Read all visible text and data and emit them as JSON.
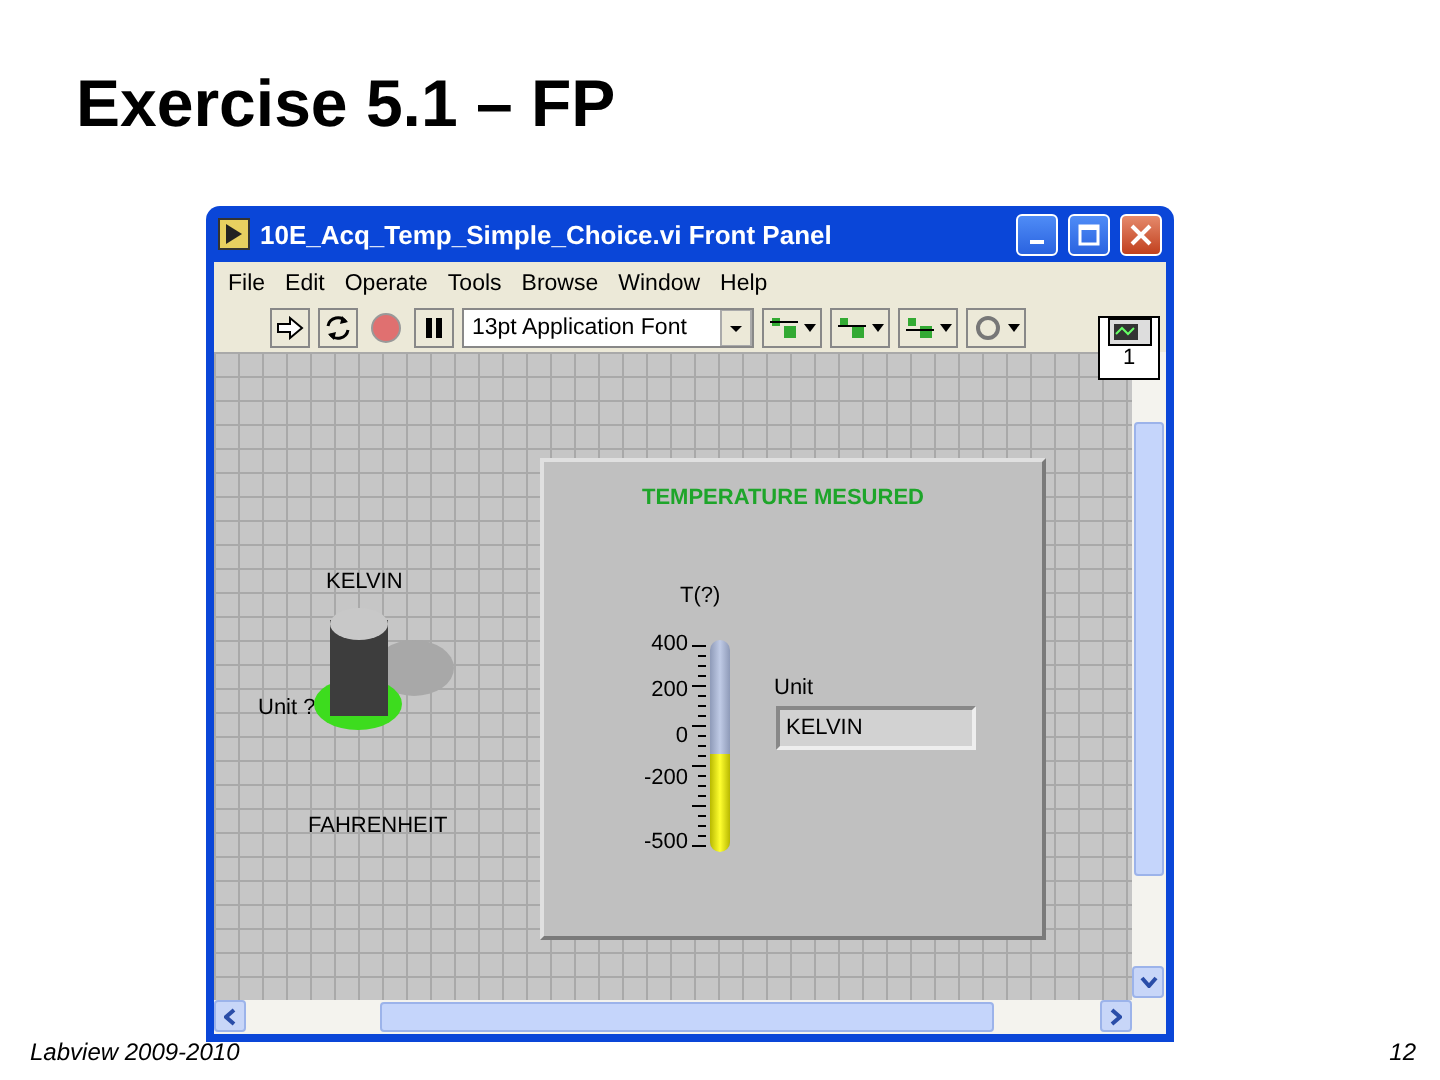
{
  "slide": {
    "title": "Exercise 5.1 – FP",
    "footer_left": "Labview 2009-2010",
    "page_number": "12"
  },
  "window": {
    "title": "10E_Acq_Temp_Simple_Choice.vi Front Panel"
  },
  "menu": [
    "File",
    "Edit",
    "Operate",
    "Tools",
    "Browse",
    "Window",
    "Help"
  ],
  "toolbar": {
    "font": "13pt Application Font",
    "connector_pane": "1"
  },
  "front_panel": {
    "switch": {
      "label": "Unit ?",
      "top_label": "KELVIN",
      "bottom_label": "FAHRENHEIT",
      "up": true
    },
    "decoration_title": "TEMPERATURE MESURED",
    "thermometer": {
      "label": "T(?)",
      "level": 0.46,
      "scale": [
        "400",
        "200",
        "0",
        "-200",
        "-500"
      ]
    },
    "indicator": {
      "label": "Unit",
      "value": "KELVIN"
    }
  }
}
